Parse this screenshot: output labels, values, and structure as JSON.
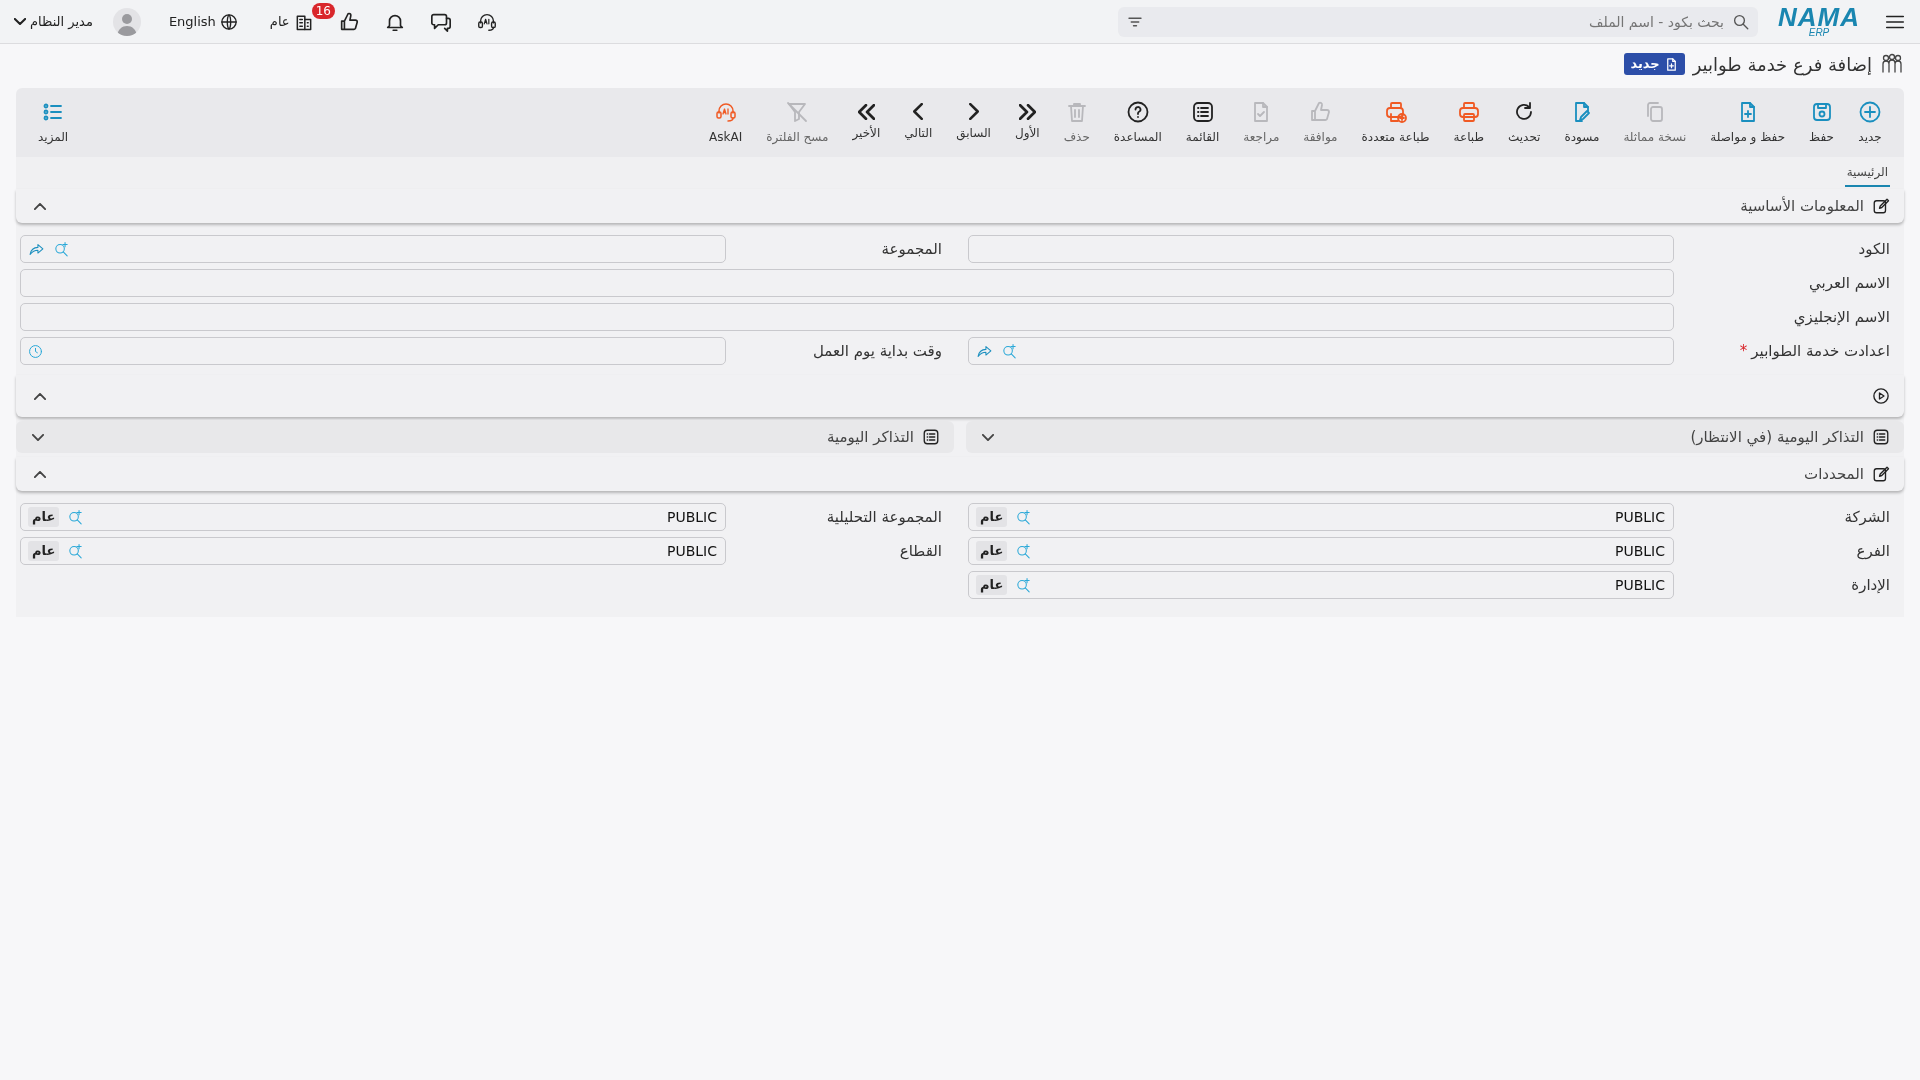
{
  "topbar": {
    "logo": "NAMA",
    "logo_sub": "ERP",
    "search": {
      "placeholder": "بحث بكود - اسم الملف"
    },
    "likes_badge": "16",
    "company": "عام",
    "language": "English",
    "user": "مدير النظام"
  },
  "page": {
    "title": "إضافة فرع خدمة طوابير",
    "status": "جديد"
  },
  "toolbar": [
    {
      "kind": "new",
      "label": "جديد",
      "disabled": false
    },
    {
      "kind": "save",
      "label": "حفظ",
      "disabled": false
    },
    {
      "kind": "save-continue",
      "label": "حفظ و مواصلة",
      "disabled": false
    },
    {
      "kind": "copy",
      "label": "نسخة مماثلة",
      "disabled": true
    },
    {
      "kind": "draft",
      "label": "مسودة",
      "disabled": false
    },
    {
      "kind": "refresh",
      "label": "تحديث",
      "disabled": false
    },
    {
      "kind": "print",
      "label": "طباعة",
      "disabled": false
    },
    {
      "kind": "multi-print",
      "label": "طباعة متعددة",
      "disabled": false
    },
    {
      "kind": "approve",
      "label": "موافقة",
      "disabled": true
    },
    {
      "kind": "review",
      "label": "مراجعة",
      "disabled": true
    },
    {
      "kind": "list",
      "label": "القائمة",
      "disabled": false
    },
    {
      "kind": "help",
      "label": "المساعدة",
      "disabled": false
    },
    {
      "kind": "delete",
      "label": "حذف",
      "disabled": true
    },
    {
      "kind": "first",
      "label": "الأول",
      "disabled": false
    },
    {
      "kind": "prev",
      "label": "السابق",
      "disabled": false
    },
    {
      "kind": "next",
      "label": "التالي",
      "disabled": false
    },
    {
      "kind": "last",
      "label": "الأخير",
      "disabled": false
    },
    {
      "kind": "clear-filter",
      "label": "مسح الفلترة",
      "disabled": true
    },
    {
      "kind": "ask-ai",
      "label": "AskAI",
      "disabled": false
    }
  ],
  "more_button": {
    "label": "المزيد"
  },
  "tabs": [
    {
      "label": "الرئيسية",
      "selected": true
    }
  ],
  "sections": [
    {
      "kind": "form",
      "title": "المعلومات الأساسية",
      "expanded": true,
      "fields": [
        {
          "kind": "text",
          "label": "الكود",
          "wide": false
        },
        {
          "kind": "lookup",
          "label": "المجموعة",
          "wide": false
        },
        {
          "kind": "text",
          "label": "الاسم العربي",
          "wide": true
        },
        {
          "kind": "text",
          "label": "الاسم الإنجليزي",
          "wide": true
        },
        {
          "kind": "lookup",
          "label": "اعدادت خدمة الطوابير",
          "wide": false,
          "required_mark": "*"
        },
        {
          "kind": "time",
          "label": "وقت بداية يوم العمل",
          "wide": false
        }
      ]
    },
    {
      "kind": "media",
      "expanded": true
    },
    {
      "kind": "panels",
      "panels": [
        {
          "title": "التذاكر اليومية (في الانتظار)",
          "expanded": false
        },
        {
          "title": "التذاكر اليومية",
          "expanded": false
        }
      ]
    },
    {
      "kind": "form",
      "title": "المحددات",
      "expanded": true,
      "fields": [
        {
          "kind": "dimension",
          "label": "الشركة",
          "value": "PUBLIC",
          "tag": "عام",
          "wide": false
        },
        {
          "kind": "dimension",
          "label": "المجموعة التحليلية",
          "value": "PUBLIC",
          "tag": "عام",
          "wide": false
        },
        {
          "kind": "dimension",
          "label": "الفرع",
          "value": "PUBLIC",
          "tag": "عام",
          "wide": false
        },
        {
          "kind": "dimension",
          "label": "القطاع",
          "value": "PUBLIC",
          "tag": "عام",
          "wide": false
        },
        {
          "kind": "dimension",
          "label": "الإدارة",
          "value": "PUBLIC",
          "tag": "عام",
          "wide": false
        }
      ]
    }
  ]
}
